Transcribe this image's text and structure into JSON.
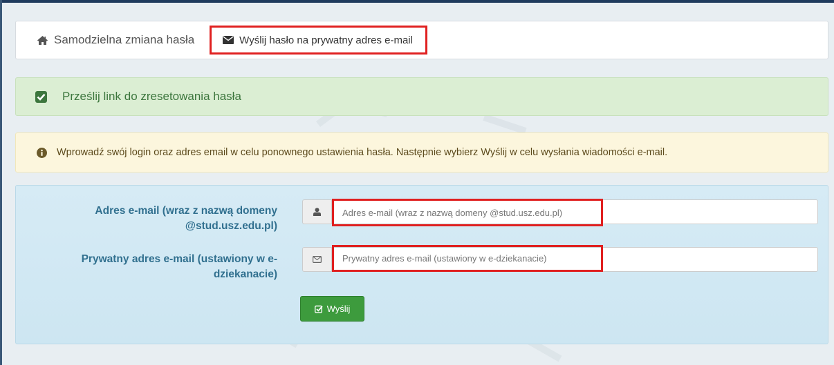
{
  "tabs": [
    {
      "label": "Samodzielna zmiana hasła",
      "icon": "home-icon"
    },
    {
      "label": "Wyślij hasło na prywatny adres e-mail",
      "icon": "envelope-icon"
    }
  ],
  "success_alert": {
    "text": "Prześlij link do zresetowania hasła",
    "icon": "check-square-icon"
  },
  "info_alert": {
    "text": "Wprowadź swój login oraz adres email w celu ponownego ustawienia hasła. Następnie wybierz Wyślij w celu wysłania wiadomości e-mail.",
    "icon": "info-circle-icon"
  },
  "form": {
    "email_label": "Adres e-mail (wraz z nazwą domeny @stud.usz.edu.pl)",
    "email_placeholder": "Adres e-mail (wraz z nazwą domeny @stud.usz.edu.pl)",
    "email_value": "",
    "private_label": "Prywatny adres e-mail (ustawiony w e-dziekanacie)",
    "private_placeholder": "Prywatny adres e-mail (ustawiony w e-dziekanacie)",
    "private_value": "",
    "submit_label": "Wyślij"
  },
  "colors": {
    "highlight": "#e02020",
    "success_bg": "#dbeed3",
    "warning_bg": "#fcf6dd",
    "panel_bg": "#d6ebf5",
    "button": "#3d9b3d"
  }
}
